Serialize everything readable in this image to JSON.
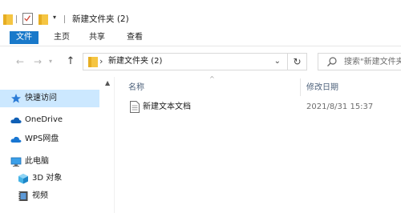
{
  "window": {
    "title": "新建文件夹 (2)"
  },
  "ribbon": {
    "tabs": [
      "文件",
      "主页",
      "共享",
      "查看"
    ]
  },
  "address": {
    "path": "新建文件夹 (2)",
    "separator": "›"
  },
  "search": {
    "placeholder": "搜索\"新建文件夹"
  },
  "nav_pane": {
    "items": [
      {
        "label": "快速访问",
        "icon": "star-icon",
        "selected": true
      },
      {
        "label": "OneDrive",
        "icon": "onedrive-cloud-icon",
        "selected": false
      },
      {
        "label": "WPS网盘",
        "icon": "wps-cloud-icon",
        "selected": false
      },
      {
        "label": "此电脑",
        "icon": "computer-icon",
        "selected": false
      },
      {
        "label": "3D 对象",
        "icon": "3d-objects-icon",
        "selected": false
      },
      {
        "label": "视频",
        "icon": "video-icon",
        "selected": false
      }
    ]
  },
  "content": {
    "columns": {
      "name": "名称",
      "modified": "修改日期"
    },
    "files": [
      {
        "name": "新建文本文档",
        "modified": "2021/8/31 15:37",
        "icon": "text-document-icon"
      }
    ]
  },
  "colors": {
    "file_tab": "#1979ca",
    "selection": "#cce8ff",
    "folder": "#f5c542",
    "header_text": "#4c607a"
  }
}
